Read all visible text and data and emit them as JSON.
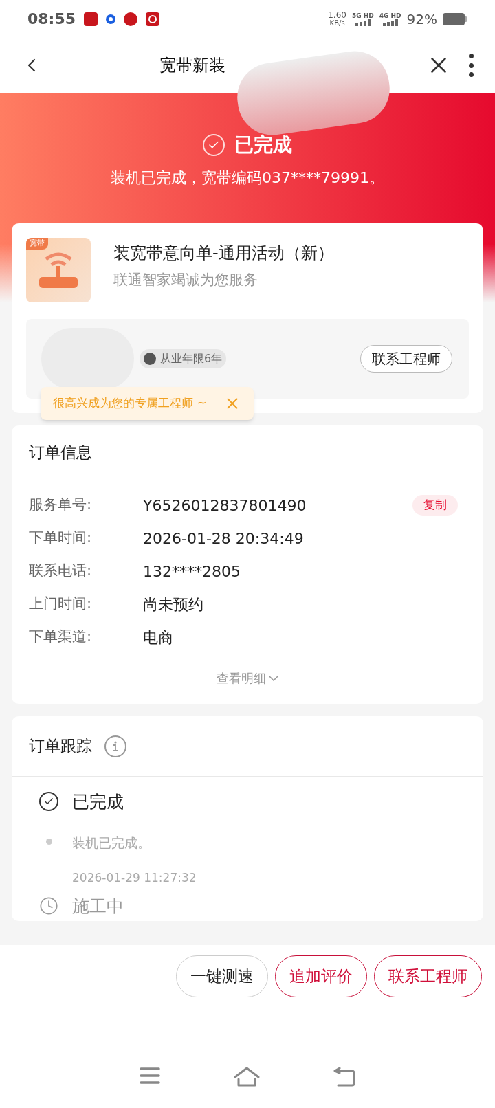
{
  "status_bar": {
    "time": "08:55",
    "speed": "1.60",
    "speed_unit": "KB/s",
    "signals": [
      "5G HD",
      "4G HD"
    ],
    "battery": "92%"
  },
  "header": {
    "title": "宽带新装"
  },
  "banner": {
    "status": "已完成",
    "message": "装机已完成，宽带编码037****79991。"
  },
  "product": {
    "badge": "宽带",
    "name": "装宽带意向单-通用活动（新）",
    "slogan": "联通智家竭诚为您服务"
  },
  "engineer": {
    "experience": "从业年限6年",
    "contact": "联系工程师",
    "tooltip": "很高兴成为您的专属工程师 ~"
  },
  "order_info": {
    "title": "订单信息",
    "rows": [
      {
        "label": "服务单号:",
        "value": "Y6526012837801490",
        "copy": "复制"
      },
      {
        "label": "下单时间:",
        "value": "2026-01-28 20:34:49"
      },
      {
        "label": "联系电话:",
        "value": "132****2805"
      },
      {
        "label": "上门时间:",
        "value": "尚未预约"
      },
      {
        "label": "下单渠道:",
        "value": "电商"
      }
    ],
    "details": "查看明细"
  },
  "tracking": {
    "title": "订单跟踪",
    "steps": [
      {
        "kind": "done",
        "title": "已完成",
        "note": "装机已完成。",
        "time": "2026-01-29 11:27:32"
      },
      {
        "kind": "pending",
        "title": "施工中"
      }
    ]
  },
  "actions": [
    {
      "label": "一键测速",
      "kind": "plain"
    },
    {
      "label": "追加评价",
      "kind": "accent"
    },
    {
      "label": "联系工程师",
      "kind": "accent"
    }
  ]
}
